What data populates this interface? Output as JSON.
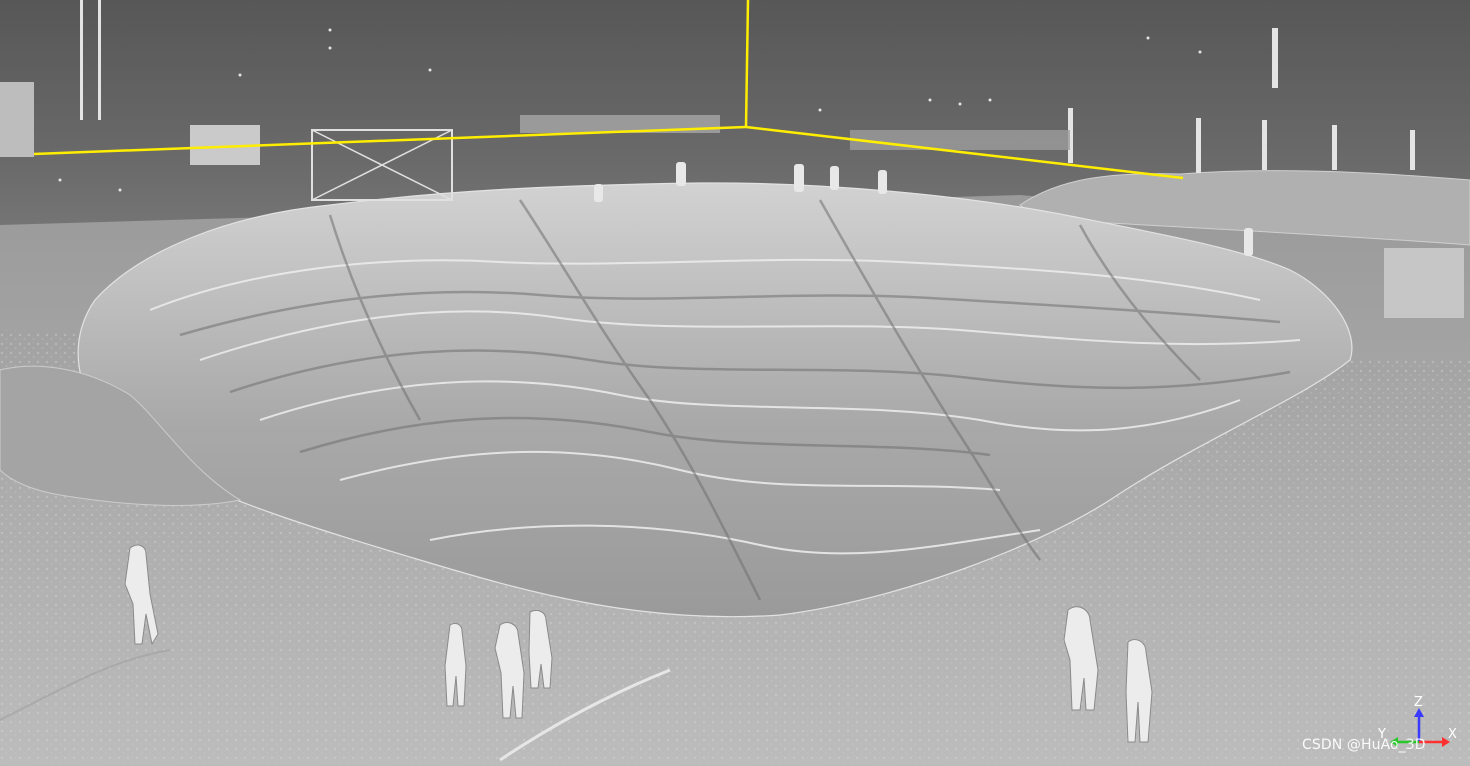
{
  "viewer": {
    "axis_labels": {
      "z": "Z",
      "y": "Y",
      "x": "X"
    },
    "axis_colors": {
      "x": "#ff3030",
      "y": "#28c828",
      "z": "#3a3aff",
      "bounding_frame": "#ffee00"
    },
    "watermark": "CSDN @HuAo_3D"
  },
  "scene": {
    "content": "point-cloud rendering of a tarp-covered material stockpile with figures",
    "colors": {
      "background_top": "#575757",
      "background_bottom": "#b4b4b4",
      "points": "#d8d8d8"
    }
  }
}
